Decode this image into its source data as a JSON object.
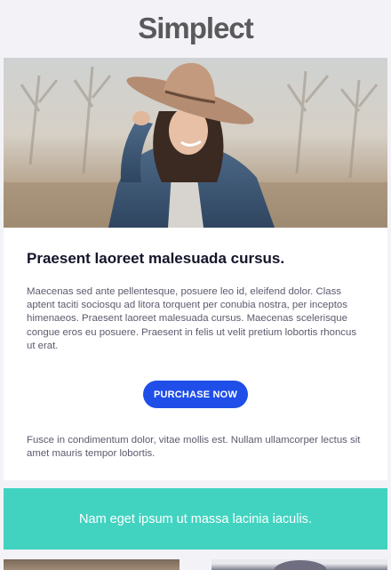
{
  "brand": {
    "logo_text": "Simplect"
  },
  "hero": {
    "image": "woman-in-hat-photo"
  },
  "article": {
    "headline": "Praesent laoreet malesuada cursus.",
    "paragraph1": "Maecenas sed ante pellentesque, posuere leo id, eleifend dolor. Class aptent taciti sociosqu ad litora torquent per conubia nostra, per inceptos himenaeos. Praesent laoreet malesuada cursus. Maecenas scelerisque congue eros eu posuere. Praesent in felis ut velit pretium lobortis rhoncus ut erat.",
    "cta_label": "PURCHASE NOW",
    "paragraph2": "Fusce in condimentum dolor, vitae mollis est. Nullam ullamcorper lectus sit amet mauris tempor lobortis."
  },
  "banner": {
    "text": "Nam eget ipsum ut massa lacinia iaculis."
  },
  "colors": {
    "cta": "#1f4ee8",
    "banner": "#41d3c0",
    "background": "#f3f3f7",
    "headline": "#14142a"
  }
}
